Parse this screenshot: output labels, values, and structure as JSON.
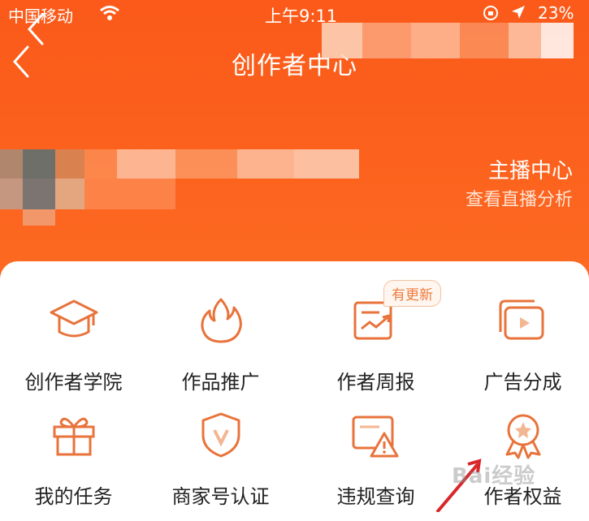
{
  "status_bar": {
    "carrier": "中国移动",
    "time": "上午9:11",
    "battery": "23%"
  },
  "nav": {
    "title": "创作者中心"
  },
  "header": {
    "anchor_center_title": "主播中心",
    "anchor_center_subtitle": "查看直播分析"
  },
  "grid": {
    "items": [
      {
        "label": "创作者学院",
        "icon": "graduation-cap-icon"
      },
      {
        "label": "作品推广",
        "icon": "flame-icon"
      },
      {
        "label": "作者周报",
        "icon": "report-chart-icon",
        "badge": "有更新"
      },
      {
        "label": "广告分成",
        "icon": "ad-play-icon"
      },
      {
        "label": "我的任务",
        "icon": "gift-icon"
      },
      {
        "label": "商家号认证",
        "icon": "verify-shield-icon"
      },
      {
        "label": "违规查询",
        "icon": "warning-doc-icon"
      },
      {
        "label": "作者权益",
        "icon": "medal-icon"
      }
    ]
  },
  "watermark": "Bai经验",
  "colors": {
    "header_orange": "#fb5f1c",
    "icon_orange": "#e8733b",
    "text_dark": "#222222"
  }
}
